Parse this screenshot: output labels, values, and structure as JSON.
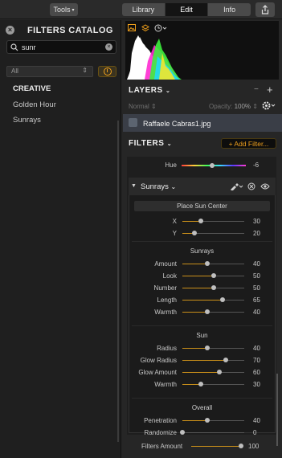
{
  "toolbar": {
    "tools_label": "Tools",
    "tabs": [
      {
        "label": "Library"
      },
      {
        "label": "Edit"
      },
      {
        "label": "Info"
      }
    ],
    "share_icon": "share-icon"
  },
  "catalog": {
    "title": "FILTERS CATALOG",
    "search_value": "sunr",
    "dropdown_value": "All",
    "category": "CREATIVE",
    "items": [
      {
        "label": "Golden Hour"
      },
      {
        "label": "Sunrays"
      }
    ]
  },
  "layers": {
    "title": "LAYERS",
    "blend": "Normal",
    "opacity_label": "Opacity:",
    "opacity_value": "100%",
    "layer_name": "Raffaele Cabras1.jpg"
  },
  "filters": {
    "title": "FILTERS",
    "add_label": "+ Add Filter...",
    "hue_label": "Hue",
    "hue_value": "-6",
    "filter_name": "Sunrays",
    "place_sun_center": "Place Sun Center",
    "xy": [
      {
        "label": "X",
        "value": 30,
        "fraction": 0.3
      },
      {
        "label": "Y",
        "value": 20,
        "fraction": 0.2
      }
    ],
    "groups": [
      {
        "title": "Sunrays",
        "rows": [
          {
            "label": "Amount",
            "value": 40
          },
          {
            "label": "Look",
            "value": 50
          },
          {
            "label": "Number",
            "value": 50
          },
          {
            "label": "Length",
            "value": 65
          },
          {
            "label": "Warmth",
            "value": 40
          }
        ]
      },
      {
        "title": "Sun",
        "rows": [
          {
            "label": "Radius",
            "value": 40
          },
          {
            "label": "Glow Radius",
            "value": 70
          },
          {
            "label": "Glow Amount",
            "value": 60
          },
          {
            "label": "Warmth",
            "value": 30
          }
        ]
      },
      {
        "title": "Overall",
        "rows": [
          {
            "label": "Penetration",
            "value": 40
          },
          {
            "label": "Randomize",
            "value": 0
          }
        ]
      }
    ],
    "amount_label": "Filters Amount",
    "amount_value": 100
  },
  "colors": {
    "accent": "#f0a01c",
    "selected_row": "#3a3e47"
  }
}
